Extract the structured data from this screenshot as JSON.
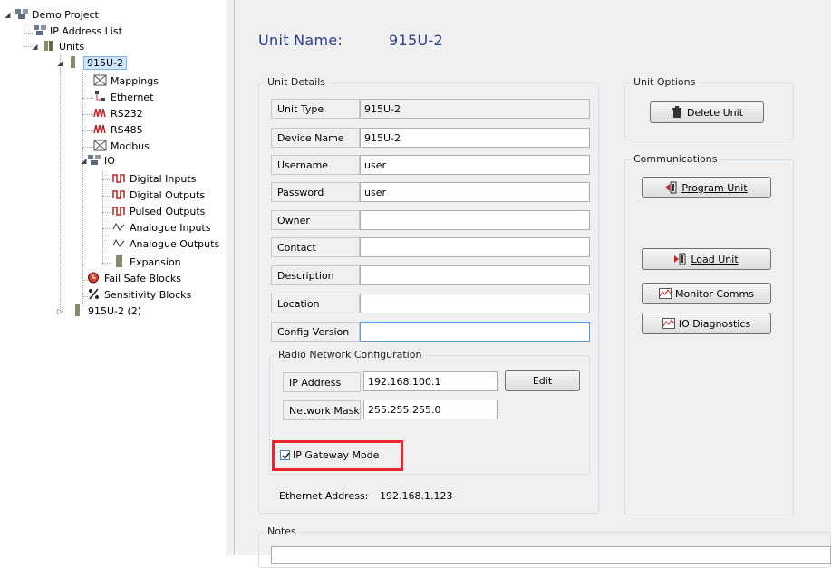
{
  "tree": {
    "root": "Demo Project",
    "ip_list": "IP Address List",
    "units": "Units",
    "unit1": "915U-2",
    "mappings": "Mappings",
    "ethernet": "Ethernet",
    "rs232": "RS232",
    "rs485": "RS485",
    "modbus": "Modbus",
    "io": "IO",
    "digital_inputs": "Digital Inputs",
    "digital_outputs": "Digital Outputs",
    "pulsed_outputs": "Pulsed Outputs",
    "analogue_inputs": "Analogue Inputs",
    "analogue_outputs": "Analogue Outputs",
    "expansion": "Expansion",
    "fail_safe": "Fail Safe Blocks",
    "sensitivity": "Sensitivity Blocks",
    "unit2": "915U-2 (2)"
  },
  "header": {
    "label": "Unit Name:",
    "value": "915U-2"
  },
  "unit_details": {
    "title": "Unit Details",
    "fields": [
      {
        "label": "Unit Type",
        "value": "915U-2"
      },
      {
        "label": "Device Name",
        "value": "915U-2"
      },
      {
        "label": "Username",
        "value": "user"
      },
      {
        "label": "Password",
        "value": "user"
      },
      {
        "label": "Owner",
        "value": ""
      },
      {
        "label": "Contact",
        "value": ""
      },
      {
        "label": "Description",
        "value": ""
      },
      {
        "label": "Location",
        "value": ""
      },
      {
        "label": "Config Version",
        "value": ""
      }
    ]
  },
  "radio": {
    "title": "Radio Network Configuration",
    "ip_label": "IP Address",
    "ip_value": "192.168.100.1",
    "mask_label": "Network Mask",
    "mask_value": "255.255.255.0",
    "edit_button": "Edit",
    "gateway_checkbox": "IP Gateway Mode",
    "gateway_checked": true
  },
  "ethernet": {
    "label": "Ethernet Address:",
    "value": "192.168.1.123"
  },
  "unit_options": {
    "title": "Unit Options",
    "delete_button": "Delete Unit"
  },
  "communications": {
    "title": "Communications",
    "program_button": "Program Unit",
    "load_button": "Load Unit",
    "monitor_button": "Monitor Comms",
    "diag_button": "IO Diagnostics"
  },
  "notes": {
    "title": "Notes"
  },
  "colors": {
    "title_blue": "#2c3e86",
    "highlight_red": "#e8262c",
    "selection": "#cfe6fb"
  }
}
